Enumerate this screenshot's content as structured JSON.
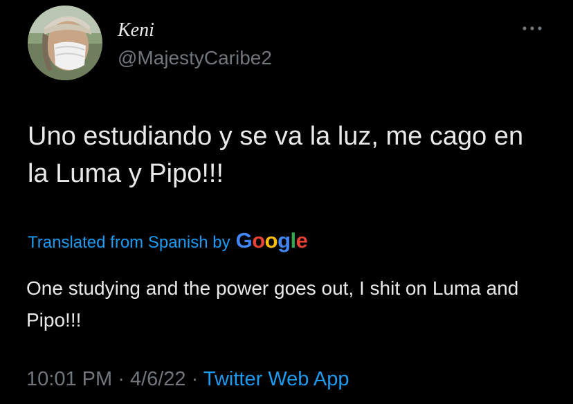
{
  "author": {
    "display_name": "Keni",
    "handle": "@MajestyCaribe2"
  },
  "tweet": {
    "text": "Uno estudiando y se va la luz, me cago en la Luma y Pipo!!!"
  },
  "translation": {
    "label": "Translated from Spanish by",
    "provider_letters": [
      "G",
      "o",
      "o",
      "g",
      "l",
      "e"
    ],
    "provider_colors": [
      "#4285F4",
      "#EA4335",
      "#FBBC05",
      "#4285F4",
      "#34A853",
      "#EA4335"
    ],
    "text": "One studying and the power goes out, I shit on Luma and Pipo!!!"
  },
  "meta": {
    "time": "10:01 PM",
    "separator": "·",
    "date": "4/6/22",
    "source": "Twitter Web App"
  },
  "icons": {
    "more": "more-horizontal-icon"
  },
  "colors": {
    "background": "#000000",
    "primary_text": "#e7e9ea",
    "secondary_text": "#71767b",
    "link": "#1d9bf0"
  }
}
